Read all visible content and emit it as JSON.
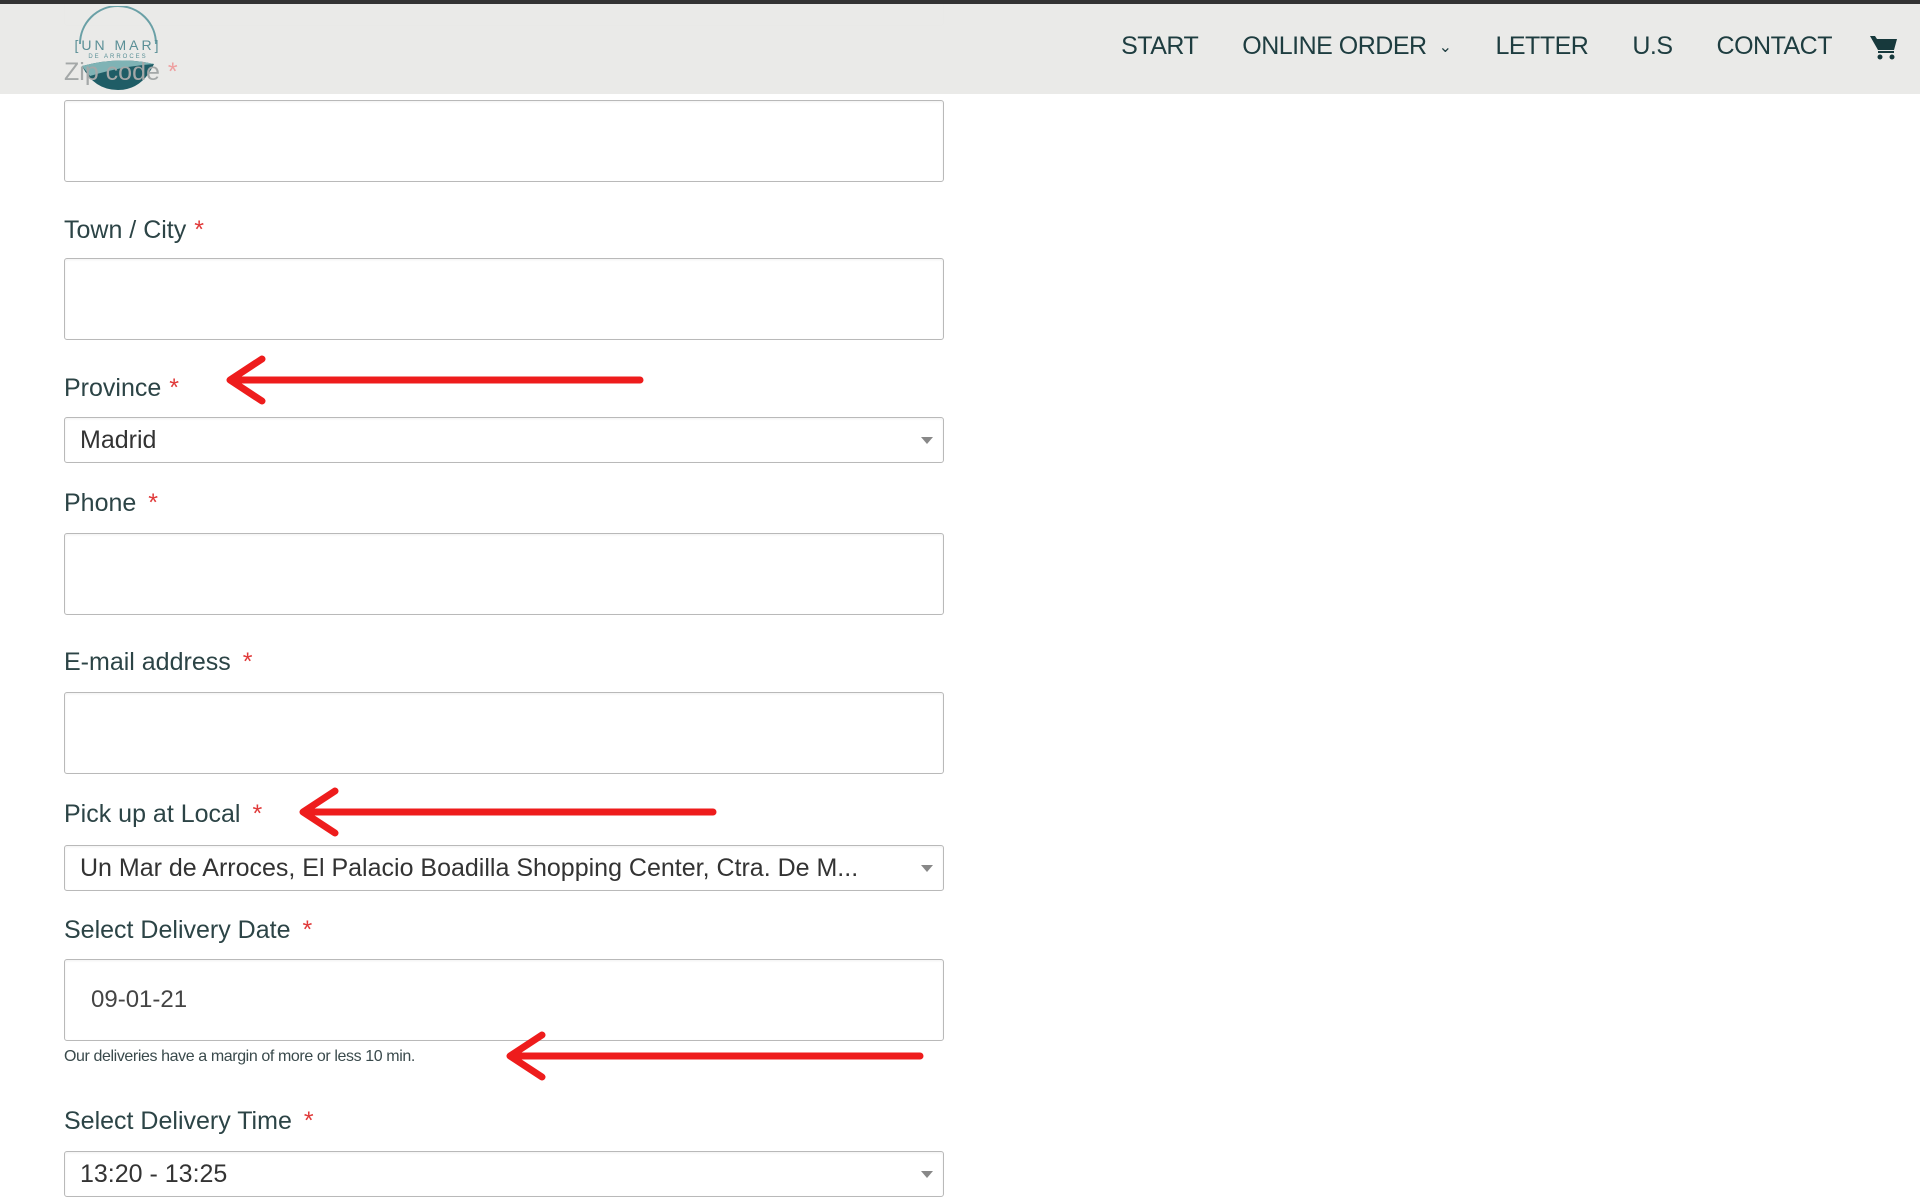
{
  "header": {
    "logo_text": "UN MAR DE ARROCES",
    "nav": [
      {
        "label": "START"
      },
      {
        "label": "ONLINE ORDER",
        "has_dropdown": true
      },
      {
        "label": "LETTER"
      },
      {
        "label": "U.S"
      },
      {
        "label": "CONTACT"
      }
    ],
    "cart_icon": "shopping-cart-icon"
  },
  "form": {
    "zip": {
      "label": "Zip code",
      "required": "*"
    },
    "town": {
      "label": "Town / City",
      "required": "*",
      "value": ""
    },
    "province": {
      "label": "Province",
      "required": "*",
      "value": "Madrid"
    },
    "phone": {
      "label": "Phone",
      "required": "*",
      "value": ""
    },
    "email": {
      "label": "E-mail address",
      "required": "*",
      "value": ""
    },
    "pickup": {
      "label": "Pick up at Local",
      "required": "*",
      "value": "Un Mar de Arroces, El Palacio Boadilla Shopping Center, Ctra. De M..."
    },
    "date": {
      "label": "Select Delivery Date",
      "required": "*",
      "value": "09-01-21",
      "note": "Our deliveries have a margin of more or less 10 min."
    },
    "time": {
      "label": "Select Delivery Time",
      "required": "*",
      "value": "13:20 - 13:25"
    }
  },
  "annotations": {
    "arrow_color": "#ee1c1c"
  }
}
